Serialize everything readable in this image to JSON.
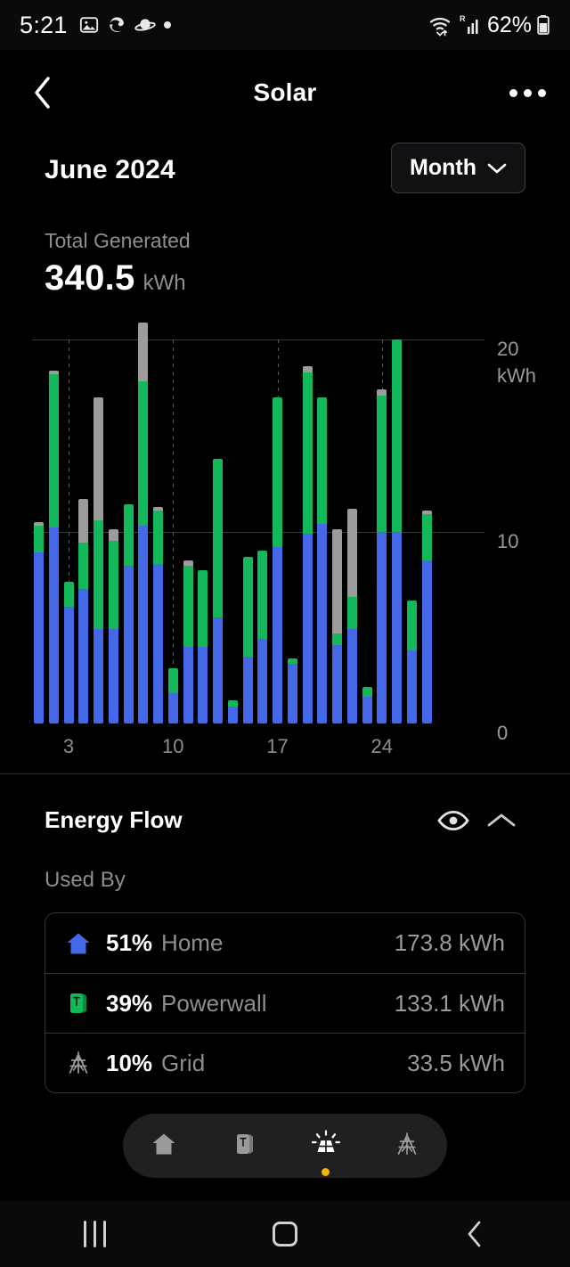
{
  "status_bar": {
    "time": "5:21",
    "left_icons": [
      "image-icon",
      "edge-browser-icon",
      "saturn-icon",
      "dot-icon"
    ],
    "right_icons": [
      "wifi-icon",
      "roaming-signal-icon",
      "cellular-signal-icon"
    ],
    "battery_text": "62%",
    "battery_icon": "battery-icon"
  },
  "app_bar": {
    "back_icon": "chevron-left-icon",
    "title": "Solar",
    "more_icon": "more-options-icon"
  },
  "summary": {
    "month": "June 2024",
    "period_label": "Month",
    "period_chevron": "chevron-down-icon",
    "total_label": "Total Generated",
    "total_value": "340.5",
    "total_unit": "kWh"
  },
  "chart_data": {
    "type": "bar",
    "title": "Solar generation by day",
    "stacked": true,
    "xlabel": "",
    "ylabel": "kWh",
    "ylim": [
      0,
      20
    ],
    "yticks": [
      0,
      10,
      20
    ],
    "ytick_labels": [
      "0",
      "10",
      "20"
    ],
    "y_unit_label": "kWh",
    "grid": "horizontal-lines-at-10-and-20, vertical-dashed-at-3-10-17-24",
    "legend_position": "none",
    "x": [
      1,
      2,
      3,
      4,
      5,
      6,
      7,
      8,
      9,
      10,
      11,
      12,
      13,
      14,
      15,
      16,
      17,
      18,
      19,
      20,
      21,
      22,
      23,
      24,
      25,
      26,
      27,
      28,
      29,
      30
    ],
    "xtick_values": [
      3,
      10,
      17,
      24
    ],
    "xtick_labels": [
      "3",
      "10",
      "17",
      "24"
    ],
    "series": [
      {
        "name": "Home",
        "color": "#4468e8",
        "values": [
          8.9,
          10.2,
          6.1,
          7.0,
          4.9,
          4.9,
          8.2,
          10.3,
          8.3,
          1.6,
          4.0,
          4.0,
          5.5,
          0.9,
          3.5,
          4.4,
          9.2,
          3.1,
          9.9,
          10.4,
          4.1,
          4.9,
          1.4,
          10.0,
          10.0,
          3.8,
          8.5
        ]
      },
      {
        "name": "Powerwall",
        "color": "#13b85a",
        "values": [
          1.4,
          8.0,
          1.3,
          2.4,
          5.7,
          4.6,
          3.2,
          7.5,
          2.8,
          1.3,
          4.2,
          4.0,
          8.3,
          0.3,
          5.2,
          4.6,
          7.8,
          0.3,
          8.4,
          6.6,
          0.6,
          1.7,
          0.5,
          7.1,
          10.0,
          2.6,
          2.4
        ]
      },
      {
        "name": "Grid",
        "color": "#9c9c9c",
        "values": [
          0.2,
          0.2,
          0,
          2.3,
          6.4,
          0.6,
          0,
          3.1,
          0.2,
          0,
          0.3,
          0,
          0,
          0,
          0,
          0,
          0,
          0,
          0.3,
          0,
          5.4,
          4.6,
          0,
          0.3,
          0,
          0,
          0.2
        ]
      }
    ],
    "bars": [
      {
        "day": 1,
        "home": 8.9,
        "powerwall": 1.4,
        "grid": 0.2
      },
      {
        "day": 2,
        "home": 10.2,
        "powerwall": 8.0,
        "grid": 0.2
      },
      {
        "day": 3,
        "home": 6.1,
        "powerwall": 1.3,
        "grid": 0.0
      },
      {
        "day": 4,
        "home": 7.0,
        "powerwall": 2.4,
        "grid": 2.3
      },
      {
        "day": 5,
        "home": 4.9,
        "powerwall": 5.7,
        "grid": 6.4
      },
      {
        "day": 6,
        "home": 4.9,
        "powerwall": 4.6,
        "grid": 0.6
      },
      {
        "day": 7,
        "home": 8.2,
        "powerwall": 3.2,
        "grid": 0.0
      },
      {
        "day": 8,
        "home": 10.3,
        "powerwall": 7.5,
        "grid": 3.1
      },
      {
        "day": 9,
        "home": 8.3,
        "powerwall": 2.8,
        "grid": 0.2
      },
      {
        "day": 10,
        "home": 1.6,
        "powerwall": 1.3,
        "grid": 0.0
      },
      {
        "day": 11,
        "home": 4.0,
        "powerwall": 4.2,
        "grid": 0.3
      },
      {
        "day": 12,
        "home": 4.0,
        "powerwall": 4.0,
        "grid": 0.0
      },
      {
        "day": 13,
        "home": 5.5,
        "powerwall": 8.3,
        "grid": 0.0
      },
      {
        "day": 14,
        "home": 0.9,
        "powerwall": 0.3,
        "grid": 0.0
      },
      {
        "day": 15,
        "home": 3.5,
        "powerwall": 5.2,
        "grid": 0.0
      },
      {
        "day": 16,
        "home": 4.4,
        "powerwall": 4.6,
        "grid": 0.0
      },
      {
        "day": 17,
        "home": 9.2,
        "powerwall": 7.8,
        "grid": 0.0
      },
      {
        "day": 18,
        "home": 3.1,
        "powerwall": 0.3,
        "grid": 0.0
      },
      {
        "day": 19,
        "home": 9.9,
        "powerwall": 8.4,
        "grid": 0.3
      },
      {
        "day": 20,
        "home": 10.4,
        "powerwall": 6.6,
        "grid": 0.0
      },
      {
        "day": 21,
        "home": 4.1,
        "powerwall": 0.6,
        "grid": 5.4
      },
      {
        "day": 22,
        "home": 4.9,
        "powerwall": 1.7,
        "grid": 4.6
      },
      {
        "day": 23,
        "home": 1.4,
        "powerwall": 0.5,
        "grid": 0.0
      },
      {
        "day": 24,
        "home": 10.0,
        "powerwall": 7.1,
        "grid": 0.3
      },
      {
        "day": 25,
        "home": 10.0,
        "powerwall": 10.0,
        "grid": 0.0
      },
      {
        "day": 26,
        "home": 3.8,
        "powerwall": 2.6,
        "grid": 0.0
      },
      {
        "day": 27,
        "home": 8.5,
        "powerwall": 2.4,
        "grid": 0.2
      }
    ]
  },
  "energy_flow": {
    "title": "Energy Flow",
    "eye_icon": "eye-icon",
    "collapse_icon": "chevron-up-icon",
    "subtitle": "Used By",
    "rows": [
      {
        "icon": "home-icon",
        "pct": "51%",
        "name": "Home",
        "value": "173.8 kWh",
        "color": "#4468e8"
      },
      {
        "icon": "powerwall-icon",
        "pct": "39%",
        "name": "Powerwall",
        "value": "133.1 kWh",
        "color": "#13b85a"
      },
      {
        "icon": "grid-tower-icon",
        "pct": "10%",
        "name": "Grid",
        "value": "33.5 kWh",
        "color": "#9a9a9c"
      }
    ]
  },
  "tab_bar": {
    "tabs": [
      {
        "icon": "home-icon",
        "name": "home-tab",
        "active": false
      },
      {
        "icon": "powerwall-icon",
        "name": "powerwall-tab",
        "active": false
      },
      {
        "icon": "solar-panel-icon",
        "name": "solar-tab",
        "active": true
      },
      {
        "icon": "grid-tower-icon",
        "name": "grid-tab",
        "active": false
      }
    ]
  },
  "nav_bar": {
    "recents_icon": "recents-icon",
    "home_icon": "home-square-icon",
    "back_icon": "back-chevron-icon"
  }
}
